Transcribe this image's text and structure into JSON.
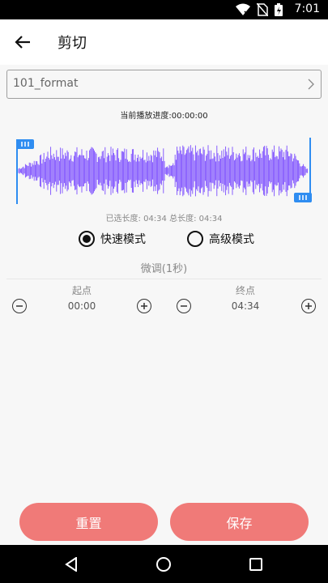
{
  "status_bar": {
    "time": "7:01",
    "icons": [
      "wifi-icon",
      "no-sim-icon",
      "battery-charging-icon"
    ]
  },
  "app_bar": {
    "title": "剪切",
    "back_icon": "arrow-back-icon"
  },
  "file": {
    "name": "101_format"
  },
  "player": {
    "progress": "当前播放进度:00:00:00"
  },
  "waveform": {
    "color": "#7b4dff",
    "handle_color": "#2f8df1"
  },
  "length": {
    "text": "已选长度: 04:34 总长度: 04:34"
  },
  "modes": {
    "fast": "快速模式",
    "advanced": "高级模式",
    "selected": "快速模式"
  },
  "fine_tune": {
    "title": "微调(1秒)",
    "start_label": "起点",
    "start_value": "00:00",
    "end_label": "终点",
    "end_value": "04:34"
  },
  "actions": {
    "reset": "重置",
    "save": "保存",
    "color": "#f07a78"
  }
}
